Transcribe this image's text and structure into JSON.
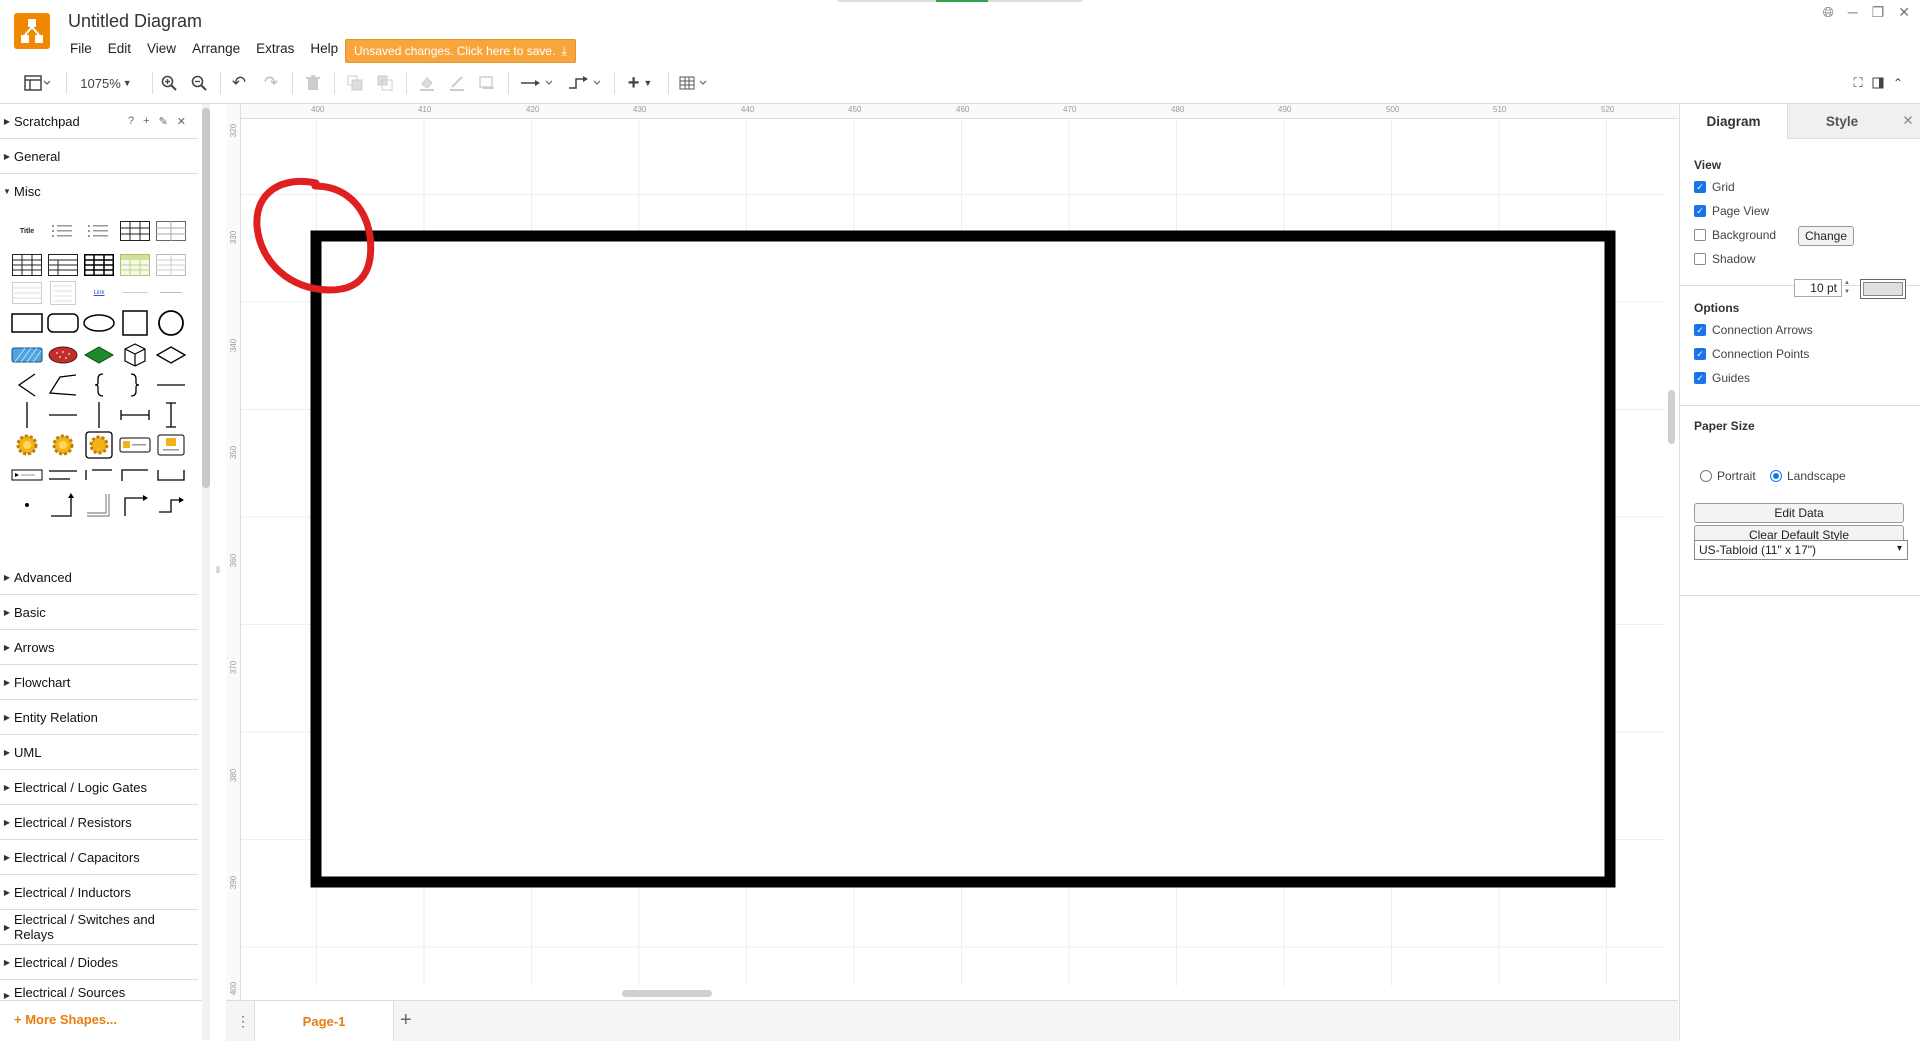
{
  "app": {
    "title": "Untitled Diagram",
    "menus": [
      "File",
      "Edit",
      "View",
      "Arrange",
      "Extras",
      "Help"
    ],
    "save_banner": "Unsaved changes. Click here to save.",
    "accent": "#f08705"
  },
  "toolbar": {
    "zoom": "1075%",
    "icons": [
      "format-panel-icon",
      "zoom-in-icon",
      "zoom-out-icon",
      "undo-icon",
      "redo-icon",
      "delete-icon",
      "to-front-icon",
      "to-back-icon",
      "fill-color-icon",
      "line-color-icon",
      "shadow-icon",
      "connection-icon",
      "waypoints-icon",
      "insert-icon",
      "table-icon"
    ]
  },
  "sidebar": {
    "sections_top": [
      "Scratchpad",
      "General",
      "Misc"
    ],
    "scratchpad_tools": [
      "?",
      "+",
      "✎",
      "✕"
    ],
    "sections_bottom": [
      "Advanced",
      "Basic",
      "Arrows",
      "Flowchart",
      "Entity Relation",
      "UML",
      "Electrical / Logic Gates",
      "Electrical / Resistors",
      "Electrical / Capacitors",
      "Electrical / Inductors",
      "Electrical / Switches and Relays",
      "Electrical / Diodes",
      "Electrical / Sources"
    ],
    "more_shapes": "+ More Shapes...",
    "misc_text": {
      "title": "Title",
      "link": "Link"
    }
  },
  "rulers": {
    "top": [
      "400",
      "410",
      "420",
      "430",
      "440",
      "450",
      "460",
      "470",
      "480",
      "490",
      "500",
      "510",
      "520"
    ],
    "left": [
      "320",
      "330",
      "340",
      "350",
      "360",
      "370",
      "380",
      "390",
      "400"
    ]
  },
  "pages": {
    "current": "Page-1"
  },
  "format_panel": {
    "tabs": [
      "Diagram",
      "Style"
    ],
    "view_heading": "View",
    "grid_label": "Grid",
    "grid_size": "10 pt",
    "page_view_label": "Page View",
    "background_label": "Background",
    "change_button": "Change",
    "shadow_label": "Shadow",
    "options_heading": "Options",
    "connection_arrows_label": "Connection Arrows",
    "connection_points_label": "Connection Points",
    "guides_label": "Guides",
    "paper_size_heading": "Paper Size",
    "paper_size_value": "US-Tabloid (11\" x 17\")",
    "portrait_label": "Portrait",
    "landscape_label": "Landscape",
    "edit_data_button": "Edit Data",
    "clear_style_button": "Clear Default Style",
    "checked": {
      "grid": true,
      "page_view": true,
      "background": false,
      "shadow": false,
      "connection_arrows": true,
      "connection_points": true,
      "guides": true
    },
    "orientation": "landscape"
  },
  "canvas": {
    "annotation_color": "#e02020",
    "shape_stroke": "#000000"
  }
}
